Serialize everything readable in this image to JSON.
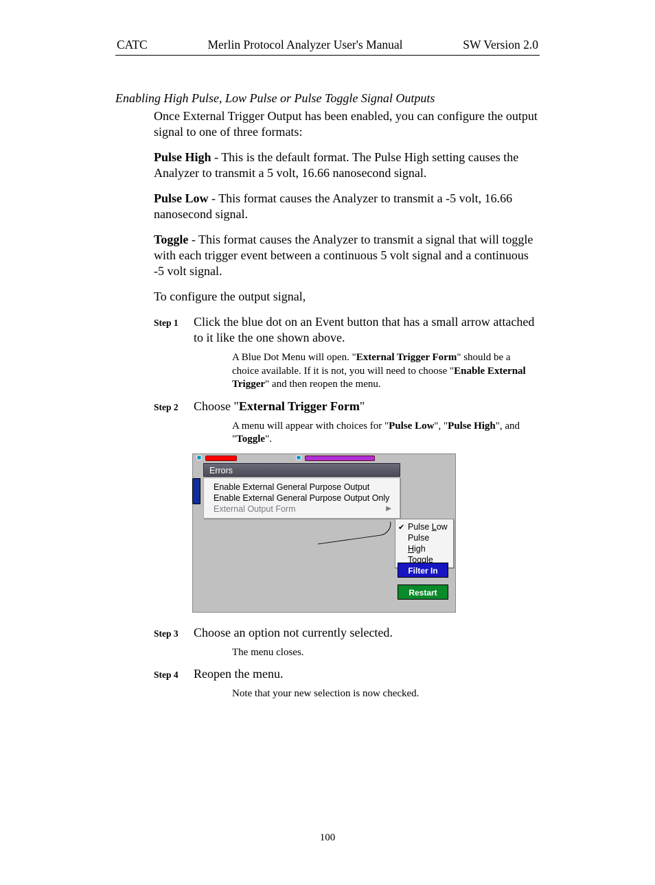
{
  "header": {
    "left": "CATC",
    "center": "Merlin Protocol Analyzer User's Manual",
    "right": "SW Version 2.0"
  },
  "section_title": "Enabling High Pulse, Low Pulse or Pulse Toggle Signal Outputs",
  "intro": "Once External Trigger Output has been enabled, you can configure the output signal to one of three formats:",
  "pulse_high": {
    "label": "Pulse High",
    "dash": " -  ",
    "text": "This is the default format.  The Pulse High setting causes the Analyzer to transmit a 5 volt, 16.66 nanosecond signal."
  },
  "pulse_low": {
    "label": "Pulse Low",
    "dash": " -  ",
    "text": "This format causes the Analyzer to transmit a -5 volt, 16.66 nanosecond signal."
  },
  "toggle": {
    "label": "Toggle",
    "dash": " -  ",
    "text": "This format causes the Analyzer to transmit a signal that will toggle with each trigger event between a continuous 5 volt signal and a continuous -5 volt signal."
  },
  "configure_line": "To configure the output signal,",
  "steps": {
    "s1": {
      "label": "Step 1",
      "text": "Click the blue dot on an Event button that has a small arrow attached to it like the one shown above."
    },
    "s1_sub_a": "A Blue Dot Menu will open.  \"",
    "s1_sub_b": "External Trigger Form",
    "s1_sub_c": "\" should be a choice available.  If it is not, you will need to choose \"",
    "s1_sub_d": "Enable External Trigger",
    "s1_sub_e": "\" and then reopen the menu.",
    "s2": {
      "label": "Step 2",
      "pre": "Choose \"",
      "bold": "External Trigger Form",
      "post": "\""
    },
    "s2_sub_a": "A menu will appear with choices for \"",
    "s2_sub_b": "Pulse Low",
    "s2_sub_c": "\", \"",
    "s2_sub_d": "Pulse High",
    "s2_sub_e": "\", and \"",
    "s2_sub_f": "Toggle",
    "s2_sub_g": "\".",
    "s3": {
      "label": "Step 3",
      "text": "Choose an option not currently selected."
    },
    "s3_sub": "The menu closes.",
    "s4": {
      "label": "Step 4",
      "text": "Reopen the menu."
    },
    "s4_sub": "Note that your new selection is now checked."
  },
  "ui": {
    "errors": "Errors",
    "menu1": "Enable External General Purpose Output",
    "menu2": "Enable External General Purpose Output Only",
    "menu3": "External Output Form",
    "sub_low_pre": "Pulse ",
    "sub_low_u": "L",
    "sub_low_post": "ow",
    "sub_high_pre": "Pulse ",
    "sub_high_u": "H",
    "sub_high_post": "igh",
    "sub_t_u": "T",
    "sub_t_post": "oggle",
    "filter": "Filter In",
    "restart": "Restart"
  },
  "pagenum": "100"
}
